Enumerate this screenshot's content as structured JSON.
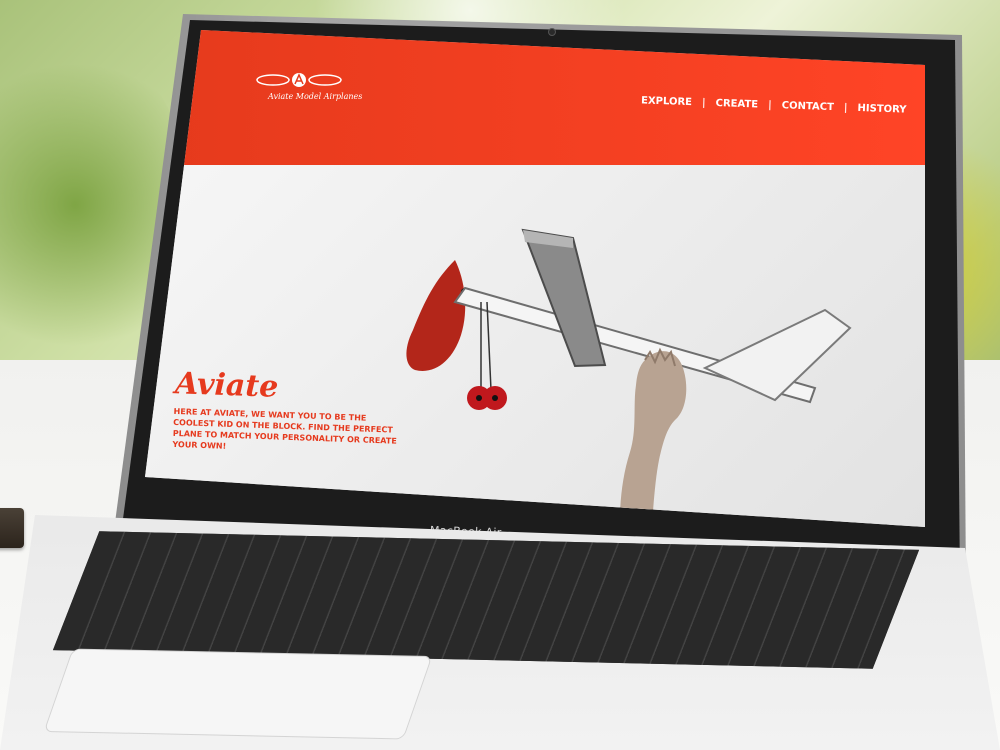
{
  "device": {
    "brand_label": "MacBook Air"
  },
  "site": {
    "logo_text": "Aviate Model Airplanes",
    "nav": [
      {
        "label": "EXPLORE"
      },
      {
        "label": "CREATE"
      },
      {
        "label": "CONTACT"
      },
      {
        "label": "HISTORY"
      }
    ],
    "nav_separator": "|",
    "hero_title": "Aviate",
    "hero_copy": "HERE AT AVIATE, WE WANT YOU TO BE THE COOLEST KID ON THE BLOCK. FIND THE PERFECT PLANE TO MATCH YOUR PERSONALITY OR CREATE YOUR OWN!"
  },
  "colors": {
    "brand_red": "#ff3f22",
    "header_white": "#ffffff",
    "background_light": "#efefef"
  },
  "icons": {
    "logo": "propeller-icon",
    "hero_image": "model-airplane-image"
  }
}
